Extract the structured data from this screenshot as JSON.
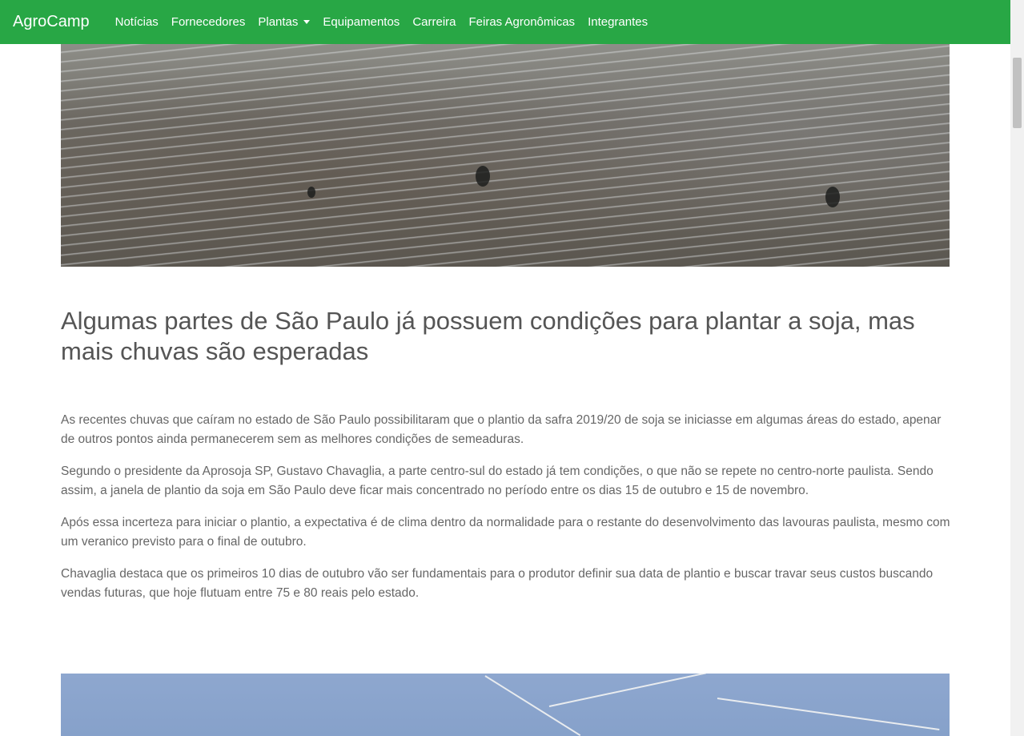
{
  "navbar": {
    "brand": "AgroCamp",
    "links": [
      {
        "label": "Notícias"
      },
      {
        "label": "Fornecedores"
      },
      {
        "label": "Plantas",
        "dropdown": true
      },
      {
        "label": "Equipamentos"
      },
      {
        "label": "Carreira"
      },
      {
        "label": "Feiras Agronômicas"
      },
      {
        "label": "Integrantes"
      }
    ]
  },
  "article": {
    "title": "Algumas partes de São Paulo já possuem condições para plantar a soja, mas mais chuvas são esperadas",
    "paragraphs": [
      "As recentes chuvas que caíram no estado de São Paulo possibilitaram que o plantio da safra 2019/20 de soja se iniciasse em algumas áreas do estado, apenar de outros pontos ainda permanecerem sem as melhores condições de semeaduras.",
      "Segundo o presidente da Aprosoja SP, Gustavo Chavaglia, a parte centro-sul do estado já tem condições, o que não se repete no centro-norte paulista. Sendo assim, a janela de plantio da soja em São Paulo deve ficar mais concentrado no período entre os dias 15 de outubro e 15 de novembro.",
      "Após essa incerteza para iniciar o plantio, a expectativa é de clima dentro da normalidade para o restante do desenvolvimento das lavouras paulista, mesmo com um veranico previsto para o final de outubro.",
      "Chavaglia destaca que os primeiros 10 dias de outubro vão ser fundamentais para o produtor definir sua data de plantio e buscar travar seus custos buscando vendas futuras, que hoje flutuam entre 75 e 80 reais pelo estado."
    ]
  },
  "colors": {
    "navbar": "#28a745",
    "text": "#555555"
  }
}
